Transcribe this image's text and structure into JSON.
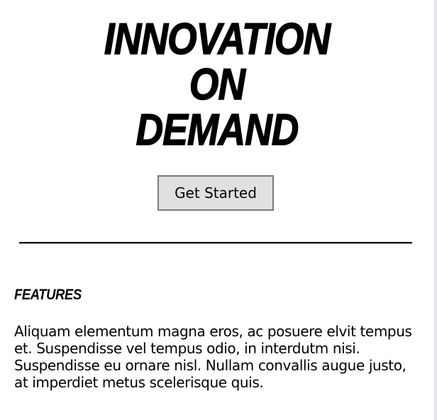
{
  "hero": {
    "title_lines": [
      "INNOVATION",
      "ON",
      "DEMAND"
    ],
    "cta_label": "Get Started"
  },
  "features": {
    "heading": "FEATURES",
    "body": "Aliquam elementum magna eros, ac posuere elvit tempus et. Suspendisse vel tempus odio, in interdutm nisi. Suspendisse eu ornare nisl. Nullam convallis augue justo, at imperdiet metus scelerisque quis."
  }
}
